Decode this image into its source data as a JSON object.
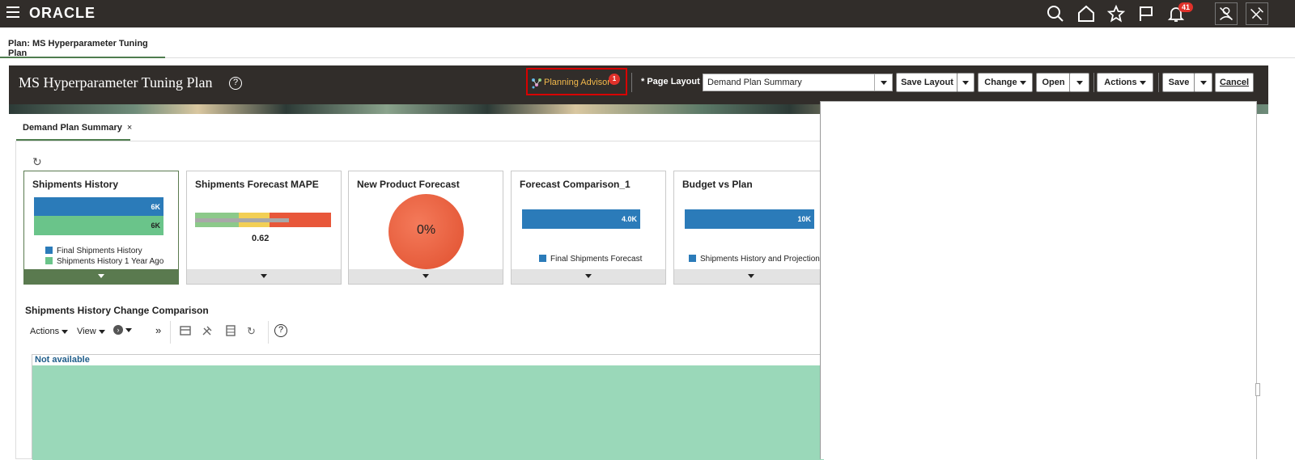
{
  "topbar": {
    "logo": "ORACLE",
    "notifications_count": "41"
  },
  "plan_tab": {
    "label": "Plan: MS Hyperparameter Tuning Plan"
  },
  "header": {
    "title": "MS Hyperparameter Tuning Plan",
    "help": "?",
    "planning_advisor": {
      "label": "Planning Advisor",
      "count": "1"
    },
    "page_layout_label": "Page Layout",
    "required_mark": "*",
    "page_layout_value": "Demand Plan Summary",
    "buttons": {
      "save_layout": "Save Layout",
      "change": "Change",
      "open": "Open",
      "actions": "Actions",
      "save": "Save",
      "cancel": "Cancel"
    }
  },
  "subtab": {
    "label": "Demand Plan Summary",
    "close": "×"
  },
  "cards": [
    {
      "title": "Shipments History",
      "legend": [
        "Final Shipments History",
        "Shipments History 1 Year Ago"
      ],
      "values": [
        "6K",
        "6K"
      ]
    },
    {
      "title": "Shipments Forecast MAPE",
      "value": "0.62",
      "fraction": 0.69
    },
    {
      "title": "New Product Forecast",
      "value": "0%"
    },
    {
      "title": "Forecast Comparison_1",
      "value": "4.0K",
      "legend": "Final Shipments Forecast"
    },
    {
      "title": "Budget vs Plan",
      "value": "10K",
      "legend": "Shipments History and Projection"
    }
  ],
  "section": {
    "title": "Shipments History Change Comparison",
    "toolbar": {
      "actions": "Actions",
      "view": "View",
      "more": "»"
    },
    "grid_header": "Not available"
  },
  "colors": {
    "topbar": "#312d2a",
    "accent_green": "#5a7a4f",
    "bar_blue": "#2b7bb9",
    "bar_green": "#6ac48a",
    "grid_fill": "#9ad8b9",
    "alert_red": "#e0312a"
  },
  "icons": [
    "hamburger-icon",
    "search-icon",
    "home-icon",
    "star-icon",
    "flag-icon",
    "bell-icon",
    "user-icon",
    "settings-icon",
    "refresh-icon",
    "help-icon",
    "export-icon",
    "tools-icon",
    "table-icon",
    "undo-icon"
  ]
}
